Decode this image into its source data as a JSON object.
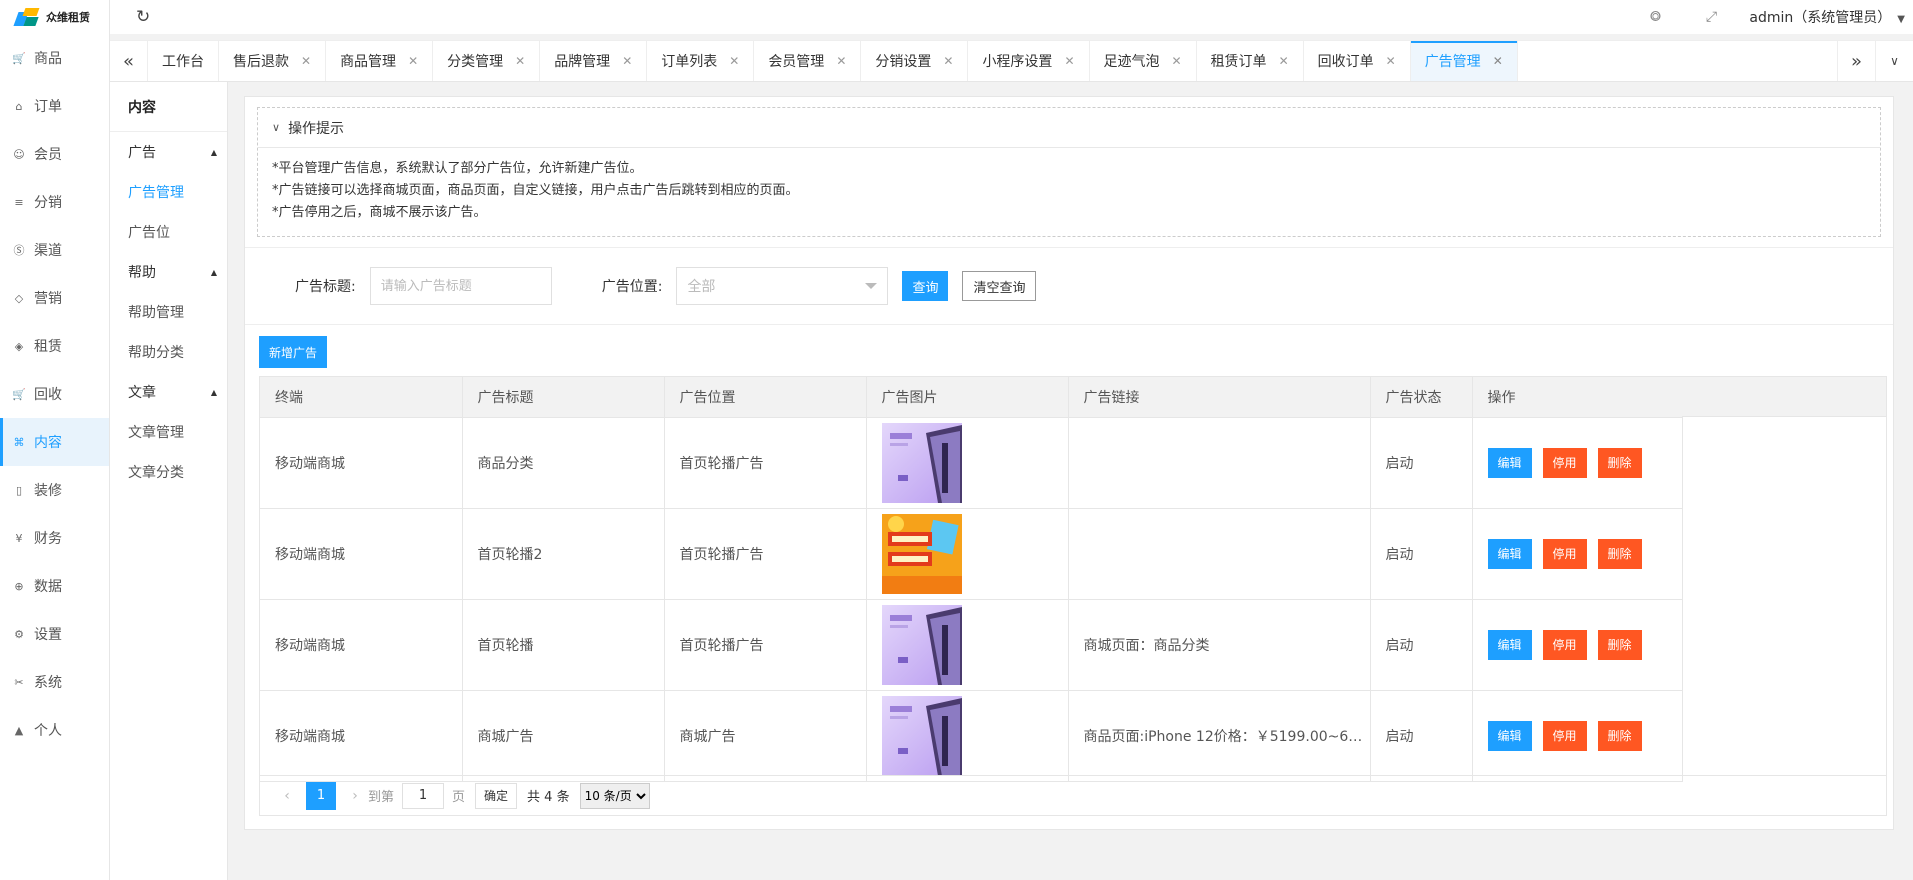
{
  "brand": {
    "name": "众维租赁",
    "accent": "#1e9fff",
    "danger": "#ff5722"
  },
  "nav": [
    {
      "label": "商品",
      "icon": "cart-icon"
    },
    {
      "label": "订单",
      "icon": "bell-icon"
    },
    {
      "label": "会员",
      "icon": "user-icon"
    },
    {
      "label": "分销",
      "icon": "layers-icon"
    },
    {
      "label": "渠道",
      "icon": "coin-icon"
    },
    {
      "label": "营销",
      "icon": "diamond-icon"
    },
    {
      "label": "租赁",
      "icon": "shield-icon"
    },
    {
      "label": "回收",
      "icon": "cart-icon"
    },
    {
      "label": "内容",
      "icon": "book-icon",
      "active": true
    },
    {
      "label": "装修",
      "icon": "phone-icon"
    },
    {
      "label": "财务",
      "icon": "yen-icon"
    },
    {
      "label": "数据",
      "icon": "globe-icon"
    },
    {
      "label": "设置",
      "icon": "gear-icon"
    },
    {
      "label": "系统",
      "icon": "tools-icon"
    },
    {
      "label": "个人",
      "icon": "person-icon"
    }
  ],
  "header": {
    "user": "admin（系统管理员）"
  },
  "tabs": [
    {
      "label": "工作台",
      "closable": false
    },
    {
      "label": "售后退款",
      "closable": true
    },
    {
      "label": "商品管理",
      "closable": true
    },
    {
      "label": "分类管理",
      "closable": true
    },
    {
      "label": "品牌管理",
      "closable": true
    },
    {
      "label": "订单列表",
      "closable": true
    },
    {
      "label": "会员管理",
      "closable": true
    },
    {
      "label": "分销设置",
      "closable": true
    },
    {
      "label": "小程序设置",
      "closable": true
    },
    {
      "label": "足迹气泡",
      "closable": true
    },
    {
      "label": "租赁订单",
      "closable": true
    },
    {
      "label": "回收订单",
      "closable": true
    },
    {
      "label": "广告管理",
      "closable": true,
      "active": true
    }
  ],
  "subnav": {
    "title": "内容",
    "groups": [
      {
        "label": "广告",
        "items": [
          {
            "label": "广告管理",
            "active": true
          },
          {
            "label": "广告位"
          }
        ]
      },
      {
        "label": "帮助",
        "items": [
          {
            "label": "帮助管理"
          },
          {
            "label": "帮助分类"
          }
        ]
      },
      {
        "label": "文章",
        "items": [
          {
            "label": "文章管理"
          },
          {
            "label": "文章分类"
          }
        ]
      }
    ]
  },
  "tips": {
    "title": "操作提示",
    "lines": [
      "*平台管理广告信息，系统默认了部分广告位，允许新建广告位。",
      "*广告链接可以选择商城页面，商品页面，自定义链接，用户点击广告后跳转到相应的页面。",
      "*广告停用之后，商城不展示该广告。"
    ]
  },
  "filters": {
    "title_label": "广告标题:",
    "title_placeholder": "请输入广告标题",
    "position_label": "广告位置:",
    "position_value": "全部",
    "query": "查询",
    "clear": "清空查询"
  },
  "add_button": "新增广告",
  "table": {
    "columns": [
      "终端",
      "广告标题",
      "广告位置",
      "广告图片",
      "广告链接",
      "广告状态",
      "操作"
    ],
    "rows": [
      {
        "terminal": "移动端商城",
        "title": "商品分类",
        "position": "首页轮播广告",
        "image": "phone-banner-image",
        "link": "",
        "status": "启动"
      },
      {
        "terminal": "移动端商城",
        "title": "首页轮播2",
        "position": "首页轮播广告",
        "image": "rental-promo-image",
        "link": "",
        "status": "启动"
      },
      {
        "terminal": "移动端商城",
        "title": "首页轮播",
        "position": "首页轮播广告",
        "image": "phone-banner-image",
        "link": "商城页面：商品分类",
        "status": "启动"
      },
      {
        "terminal": "移动端商城",
        "title": "商城广告",
        "position": "商城广告",
        "image": "phone-banner-image",
        "link": "商品页面:iPhone 12价格：￥5199.00~63...",
        "status": "启动"
      }
    ],
    "actions": {
      "edit": "编辑",
      "stop": "停用",
      "delete": "删除"
    }
  },
  "pager": {
    "current": "1",
    "goto_label": "到第",
    "page_value": "1",
    "page_unit": "页",
    "confirm": "确定",
    "total": "共 4 条",
    "page_size": "10 条/页"
  }
}
